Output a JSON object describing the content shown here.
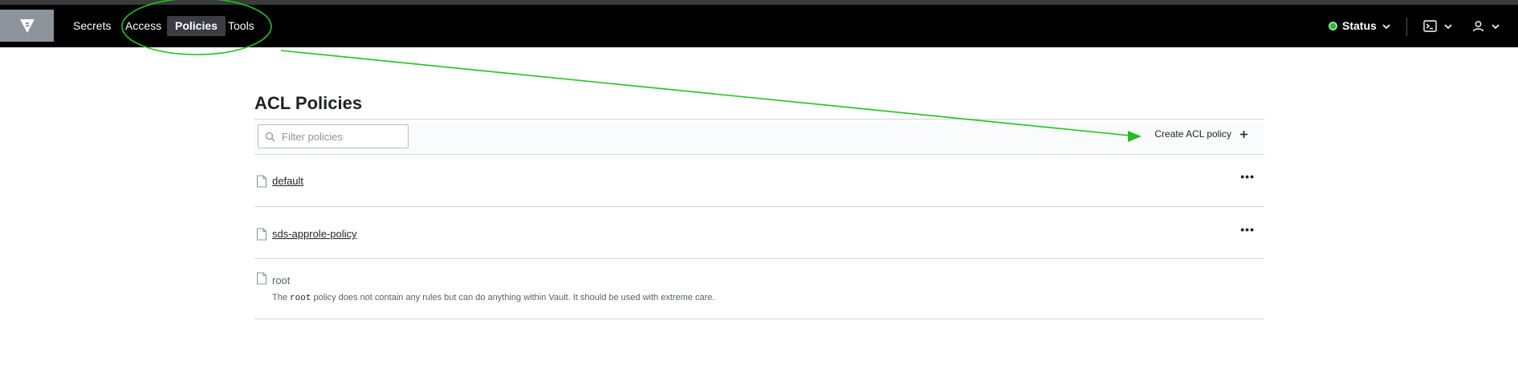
{
  "nav": {
    "items": [
      {
        "label": "Secrets",
        "active": false
      },
      {
        "label": "Access",
        "active": false
      },
      {
        "label": "Policies",
        "active": true
      },
      {
        "label": "Tools",
        "active": false
      }
    ],
    "status_label": "Status",
    "status_color": "#2eb039"
  },
  "page": {
    "title": "ACL Policies"
  },
  "toolbar": {
    "filter_placeholder": "Filter policies",
    "filter_value": "",
    "create_label": "Create ACL policy"
  },
  "policies": [
    {
      "name": "default",
      "linked": true,
      "has_menu": true
    },
    {
      "name": "sds-approle-policy",
      "linked": true,
      "has_menu": true
    },
    {
      "name": "root",
      "linked": false,
      "has_menu": false,
      "description_pre": "The ",
      "description_code": "root",
      "description_post": " policy does not contain any rules but can do anything within Vault. It should be used with extreme care."
    }
  ],
  "icons": {
    "logo": "vault-logo-icon",
    "search": "search-icon",
    "plus": "plus-icon",
    "file": "file-icon",
    "ellipsis": "more-icon",
    "terminal": "terminal-icon",
    "user": "user-icon",
    "chevron": "chevron-down-icon"
  },
  "annotation": {
    "color": "#22c022"
  }
}
